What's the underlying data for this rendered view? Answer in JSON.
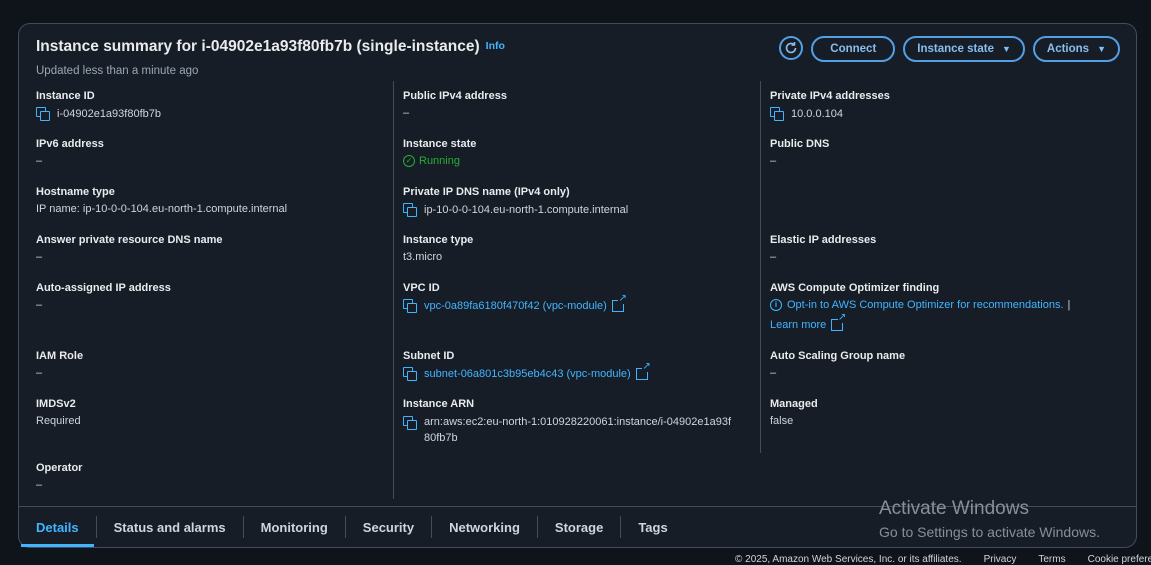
{
  "header": {
    "title": "Instance summary for i-04902e1a93f80fb7b (single-instance)",
    "info": "Info",
    "updated": "Updated less than a minute ago"
  },
  "buttons": {
    "refresh_icon": "refresh-icon",
    "connect": "Connect",
    "instance_state": "Instance state",
    "actions": "Actions"
  },
  "col1": {
    "instance_id": {
      "label": "Instance ID",
      "value": "i-04902e1a93f80fb7b"
    },
    "ipv6": {
      "label": "IPv6 address",
      "value": "–"
    },
    "hostname_type": {
      "label": "Hostname type",
      "value": "IP name: ip-10-0-0-104.eu-north-1.compute.internal"
    },
    "answer_dns": {
      "label": "Answer private resource DNS name",
      "value": "–"
    },
    "auto_ip": {
      "label": "Auto-assigned IP address",
      "value": "–"
    },
    "iam_role": {
      "label": "IAM Role",
      "value": "–"
    },
    "imdsv2": {
      "label": "IMDSv2",
      "value": "Required"
    },
    "operator": {
      "label": "Operator",
      "value": "–"
    }
  },
  "col2": {
    "public_ipv4": {
      "label": "Public IPv4 address",
      "value": "–"
    },
    "instance_state": {
      "label": "Instance state",
      "value": "Running"
    },
    "private_dns": {
      "label": "Private IP DNS name (IPv4 only)",
      "value": "ip-10-0-0-104.eu-north-1.compute.internal"
    },
    "instance_type": {
      "label": "Instance type",
      "value": "t3.micro"
    },
    "vpc_id": {
      "label": "VPC ID",
      "value": "vpc-0a89fa6180f470f42 (vpc-module)"
    },
    "subnet_id": {
      "label": "Subnet ID",
      "value": "subnet-06a801c3b95eb4c43 (vpc-module)"
    },
    "instance_arn": {
      "label": "Instance ARN",
      "value_line1": "arn:aws:ec2:eu-north-1:010928220061:instance/i-04902e1a93f",
      "value_line2": "80fb7b"
    }
  },
  "col3": {
    "private_ipv4": {
      "label": "Private IPv4 addresses",
      "value": "10.0.0.104"
    },
    "public_dns": {
      "label": "Public DNS",
      "value": "–"
    },
    "elastic_ip": {
      "label": "Elastic IP addresses",
      "value": "–"
    },
    "optimizer": {
      "label": "AWS Compute Optimizer finding",
      "value": "Opt-in to AWS Compute Optimizer for recommendations.",
      "sep": "|",
      "learn_more": "Learn more"
    },
    "asg": {
      "label": "Auto Scaling Group name",
      "value": "–"
    },
    "managed": {
      "label": "Managed",
      "value": "false"
    }
  },
  "tabs": [
    "Details",
    "Status and alarms",
    "Monitoring",
    "Security",
    "Networking",
    "Storage",
    "Tags"
  ],
  "watermark": {
    "line1": "Activate Windows",
    "line2": "Go to Settings to activate Windows."
  },
  "footer": {
    "copyright": "© 2025, Amazon Web Services, Inc. or its affiliates.",
    "privacy": "Privacy",
    "terms": "Terms",
    "cookies": "Cookie preferences"
  },
  "colors": {
    "accent": "#42b4ff",
    "running": "#29ad32",
    "background": "#0f141a",
    "panel": "#161d26"
  }
}
